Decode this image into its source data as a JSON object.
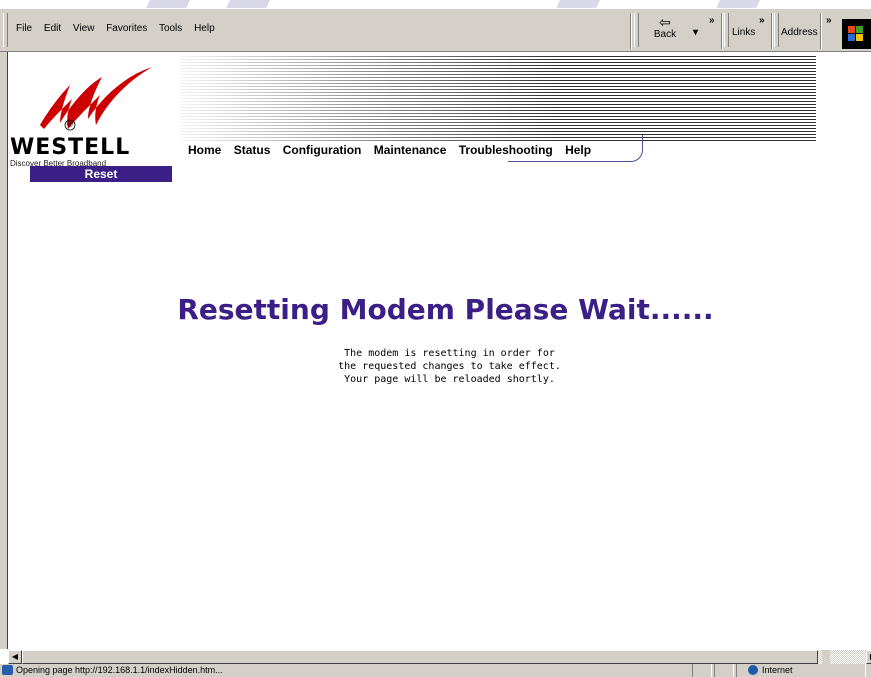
{
  "menu": {
    "file": "File",
    "edit": "Edit",
    "view": "View",
    "favorites": "Favorites",
    "tools": "Tools",
    "help": "Help"
  },
  "toolbar": {
    "back_label": "Back",
    "links_label": "Links",
    "address_label": "Address",
    "chevron": "»",
    "dropdown_arrow": "▾"
  },
  "brand": {
    "name": "WESTELL",
    "tagline": "Discover  Better  Broadband",
    "registered": "®",
    "accent_color": "#3b1f86",
    "logo_color": "#cc0000"
  },
  "sidebar": {
    "active_page": "Reset"
  },
  "nav": {
    "items": [
      "Home",
      "Status",
      "Configuration",
      "Maintenance",
      "Troubleshooting",
      "Help"
    ]
  },
  "main": {
    "headline": "Resetting Modem Please Wait......",
    "message_lines": [
      "The modem is resetting in order for",
      "the requested changes to take effect.",
      "Your page will be reloaded shortly."
    ]
  },
  "status_bar": {
    "text": "Opening page http://192.168.1.1/indexHidden.htm...",
    "zone": "Internet"
  },
  "icons": {
    "back": "back-arrow-icon",
    "windows": "windows-logo-icon",
    "zone": "internet-globe-icon"
  }
}
